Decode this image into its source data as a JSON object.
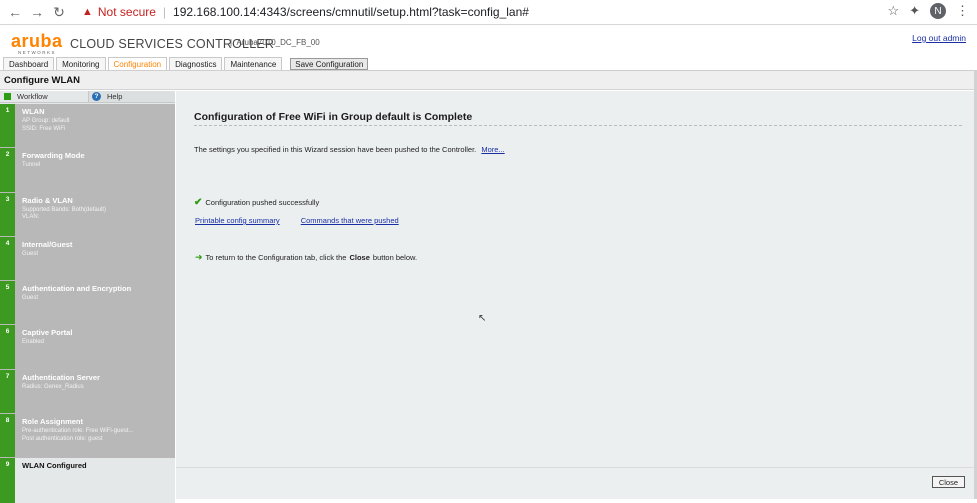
{
  "browser": {
    "security_label": "Not secure",
    "url": "192.168.100.14:4343/screens/cmnutil/setup.html?task=config_lan#",
    "profile_initial": "N"
  },
  "header": {
    "logo_word": "aruba",
    "logo_sub": "NETWORKS",
    "product": "CLOUD SERVICES CONTROLLER",
    "device": "Aruba7010_DC_FB_00",
    "logout": "Log out admin"
  },
  "tabs": [
    {
      "label": "Dashboard"
    },
    {
      "label": "Monitoring"
    },
    {
      "label": "Configuration",
      "active": true
    },
    {
      "label": "Diagnostics"
    },
    {
      "label": "Maintenance"
    }
  ],
  "save_config_label": "Save Configuration",
  "page_title": "Configure WLAN",
  "panel": {
    "workflow_label": "Workflow",
    "help_label": "Help"
  },
  "steps": [
    {
      "num": "1",
      "title": "WLAN",
      "sub": [
        "AP Group: default",
        "SSID: Free WiFi"
      ]
    },
    {
      "num": "2",
      "title": "Forwarding Mode",
      "sub": [
        "Tunnel"
      ]
    },
    {
      "num": "3",
      "title": "Radio & VLAN",
      "sub": [
        "Supported Bands: Both(default)",
        "VLAN:"
      ]
    },
    {
      "num": "4",
      "title": "Internal/Guest",
      "sub": [
        "Guest"
      ]
    },
    {
      "num": "5",
      "title": "Authentication and Encryption",
      "sub": [
        "Guest"
      ]
    },
    {
      "num": "6",
      "title": "Captive Portal",
      "sub": [
        "Enabled"
      ]
    },
    {
      "num": "7",
      "title": "Authentication Server",
      "sub": [
        "Radius: Genex_Radius"
      ]
    },
    {
      "num": "8",
      "title": "Role Assignment",
      "sub": [
        "Pre-authentication role: Free WiFi-guest...",
        "Post authentication role: guest"
      ]
    },
    {
      "num": "9",
      "title": "WLAN Configured",
      "sub": [],
      "current": true
    }
  ],
  "content": {
    "heading": "Configuration of Free WiFi in Group default is Complete",
    "line1": "The settings you specified in this Wizard session have been pushed to the Controller.",
    "more_link": "More...",
    "pushed": "Configuration pushed successfully",
    "link_summary": "Printable config summary",
    "link_commands": "Commands that were pushed",
    "return_pre": "To return to the Configuration tab, click the",
    "return_bold": "Close",
    "return_post": "button below.",
    "close_label": "Close"
  }
}
